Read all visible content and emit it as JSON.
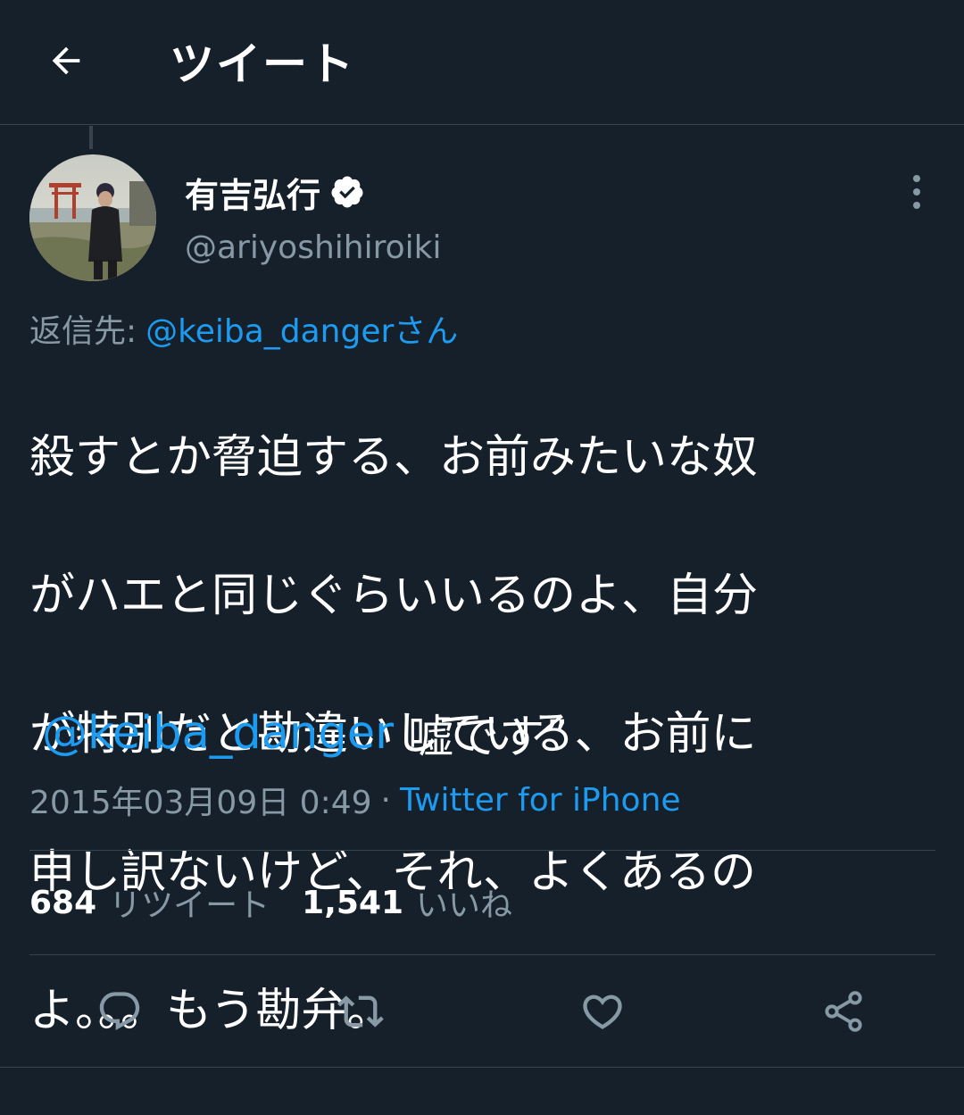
{
  "header": {
    "title": "ツイート",
    "back_icon": "arrow-left-icon"
  },
  "tweet": {
    "author": {
      "name": "有吉弘行",
      "handle": "@ariyoshihiroiki",
      "verified": true,
      "verified_icon": "verified-badge-icon"
    },
    "more_icon": "more-vertical-icon",
    "reply_to": {
      "prefix": "返信先:",
      "mention": "@keiba_dangerさん"
    },
    "text_lines": [
      "殺すとか脅迫する、お前みたいな奴",
      "がハエと同じぐらいいるのよ、自分",
      "が特別だと勘違いしている、お前に",
      "申し訳ないけど、それ、よくあるの",
      "よ。。。もう勘弁。"
    ],
    "mention_line": {
      "mention": "@keiba_danger",
      "rest": "嘘です”"
    },
    "timestamp": "2015年03月09日 0:49",
    "separator": "·",
    "source": "Twitter for iPhone",
    "stats": {
      "retweets_count": "684",
      "retweets_label": "リツイート",
      "likes_count": "1,541",
      "likes_label": "いいね"
    },
    "actions": [
      {
        "icon": "reply-icon"
      },
      {
        "icon": "retweet-icon"
      },
      {
        "icon": "like-icon"
      },
      {
        "icon": "share-icon"
      }
    ]
  },
  "colors": {
    "background": "#15202b",
    "text_primary": "#ffffff",
    "text_secondary": "#8899a6",
    "accent": "#1d9bf0",
    "border": "#38444d"
  }
}
